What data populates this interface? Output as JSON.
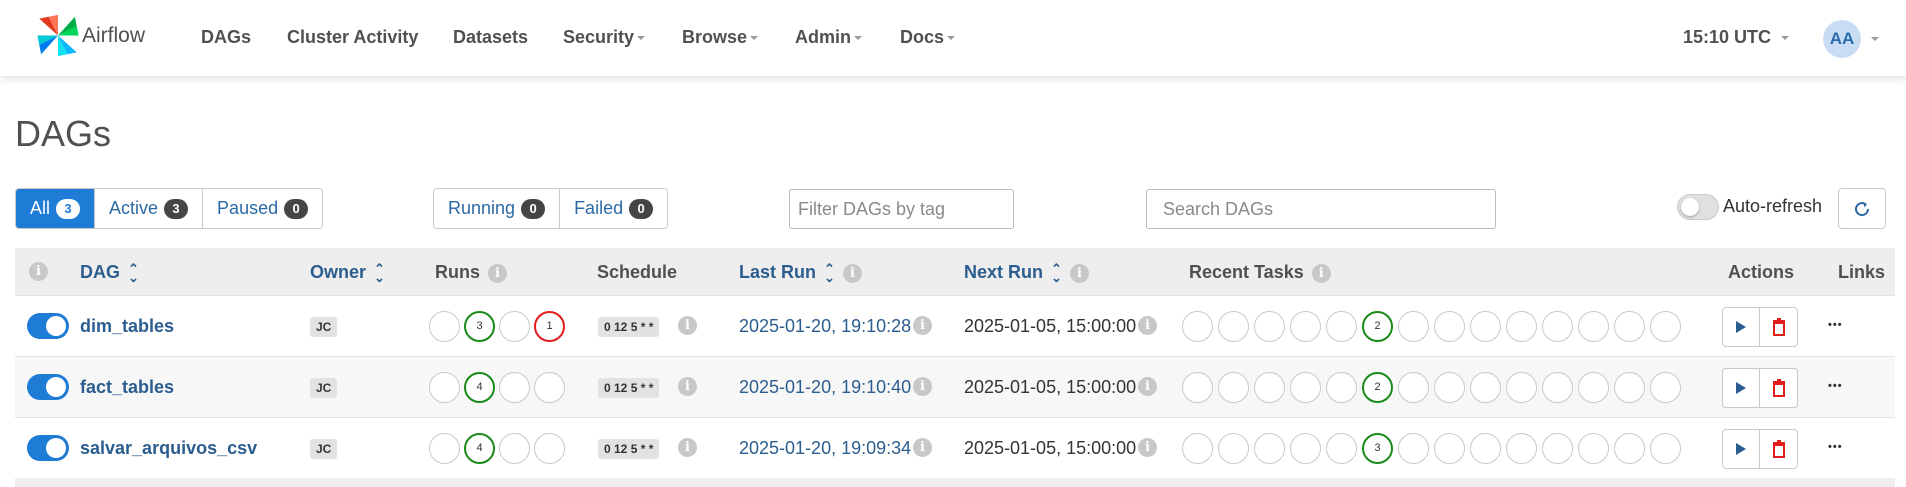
{
  "navbar": {
    "brand": "Airflow",
    "items": [
      {
        "label": "DAGs",
        "dropdown": false
      },
      {
        "label": "Cluster Activity",
        "dropdown": false
      },
      {
        "label": "Datasets",
        "dropdown": false
      },
      {
        "label": "Security",
        "dropdown": true
      },
      {
        "label": "Browse",
        "dropdown": true
      },
      {
        "label": "Admin",
        "dropdown": true
      },
      {
        "label": "Docs",
        "dropdown": true
      }
    ],
    "clock": "15:10 UTC",
    "avatar_initials": "AA"
  },
  "page_title": "DAGs",
  "status_filters": [
    {
      "label": "All",
      "count": "3",
      "active": true
    },
    {
      "label": "Active",
      "count": "3",
      "active": false
    },
    {
      "label": "Paused",
      "count": "0",
      "active": false
    }
  ],
  "run_filters": [
    {
      "label": "Running",
      "count": "0"
    },
    {
      "label": "Failed",
      "count": "0"
    }
  ],
  "tag_filter": {
    "placeholder": "Filter DAGs by tag"
  },
  "search": {
    "placeholder": "Search DAGs"
  },
  "auto_refresh": {
    "label": "Auto-refresh",
    "enabled": false
  },
  "colors": {
    "primary": "#1e7bd6",
    "success": "#1a8a1a",
    "failed": "#e01c1c",
    "link": "#2c5d8f"
  },
  "table": {
    "headers": {
      "dag": "DAG",
      "owner": "Owner",
      "runs": "Runs",
      "schedule": "Schedule",
      "last_run": "Last Run",
      "next_run": "Next Run",
      "recent_tasks": "Recent Tasks",
      "actions": "Actions",
      "links": "Links"
    },
    "rows": [
      {
        "dag_id": "dim_tables",
        "enabled": true,
        "owner": "JC",
        "runs": [
          "",
          "3",
          "",
          "1"
        ],
        "schedule": "0 12 5 * *",
        "last_run": "2025-01-20, 19:10:28",
        "next_run": "2025-01-05, 15:00:00",
        "recent_tasks_highlight": "2"
      },
      {
        "dag_id": "fact_tables",
        "enabled": true,
        "owner": "JC",
        "runs": [
          "",
          "4",
          "",
          ""
        ],
        "schedule": "0 12 5 * *",
        "last_run": "2025-01-20, 19:10:40",
        "next_run": "2025-01-05, 15:00:00",
        "recent_tasks_highlight": "2"
      },
      {
        "dag_id": "salvar_arquivos_csv",
        "enabled": true,
        "owner": "JC",
        "runs": [
          "",
          "4",
          "",
          ""
        ],
        "schedule": "0 12 5 * *",
        "last_run": "2025-01-20, 19:09:34",
        "next_run": "2025-01-05, 15:00:00",
        "recent_tasks_highlight": "3"
      }
    ]
  }
}
